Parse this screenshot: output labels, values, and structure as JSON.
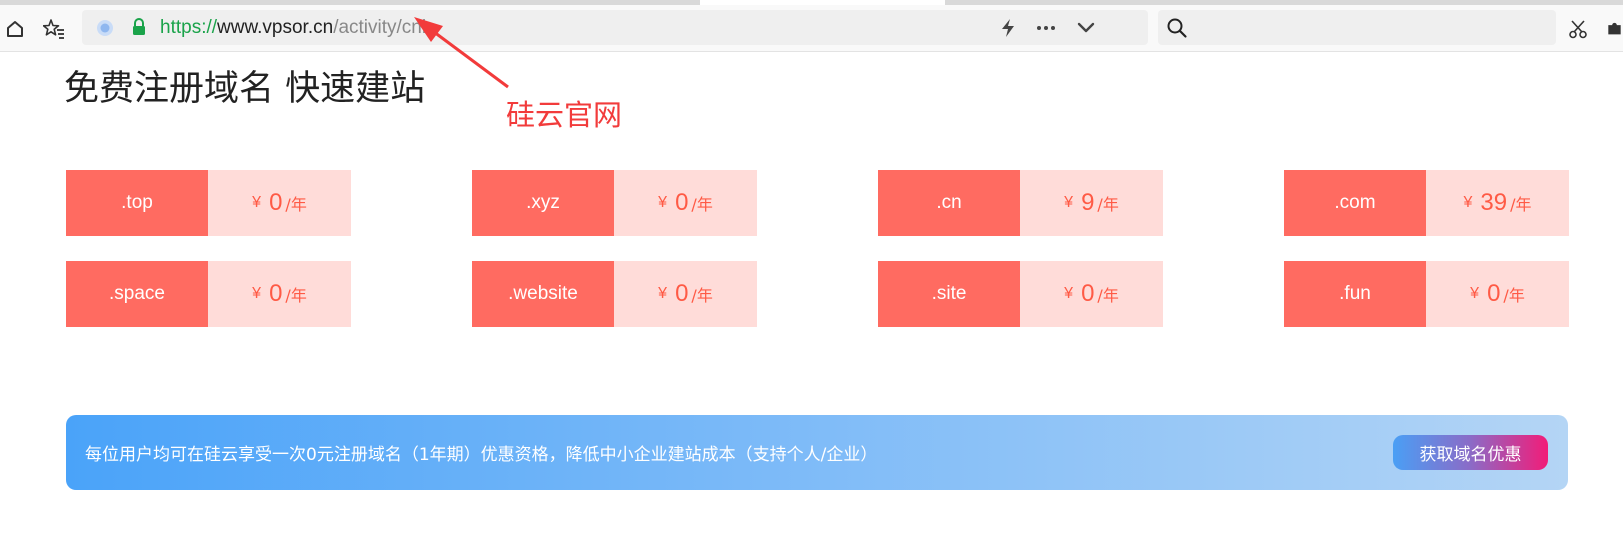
{
  "browser": {
    "url": {
      "protocol": "https://",
      "host": "www.vpsor.cn",
      "path": "/activity/cnh"
    },
    "search": {
      "placeholder": ""
    }
  },
  "page": {
    "headline": "免费注册域名 快速建站",
    "annotation": "硅云官网"
  },
  "domains": [
    {
      "tld": ".top",
      "currency": "¥",
      "price": "0",
      "unit": "/年"
    },
    {
      "tld": ".xyz",
      "currency": "¥",
      "price": "0",
      "unit": "/年"
    },
    {
      "tld": ".cn",
      "currency": "¥",
      "price": "9",
      "unit": "/年"
    },
    {
      "tld": ".com",
      "currency": "¥",
      "price": "39",
      "unit": "/年"
    },
    {
      "tld": ".space",
      "currency": "¥",
      "price": "0",
      "unit": "/年"
    },
    {
      "tld": ".website",
      "currency": "¥",
      "price": "0",
      "unit": "/年"
    },
    {
      "tld": ".site",
      "currency": "¥",
      "price": "0",
      "unit": "/年"
    },
    {
      "tld": ".fun",
      "currency": "¥",
      "price": "0",
      "unit": "/年"
    }
  ],
  "banner": {
    "text": "每位用户均可在硅云享受一次0元注册域名（1年期）优惠资格，降低中小企业建站成本（支持个人/企业）",
    "button": "获取域名优惠"
  },
  "colors": {
    "tld_bg": "#ff6b61",
    "price_bg": "#ffdcd9",
    "price_text": "#ff5a45",
    "annotation": "#f23b3b"
  },
  "icons": {
    "toolbar": [
      "home-icon",
      "bookmark-star-icon"
    ],
    "url_actions": [
      "lightning-icon",
      "more-icon",
      "chevron-down-icon"
    ],
    "right": [
      "scissors-icon",
      "puzzle-icon"
    ]
  }
}
